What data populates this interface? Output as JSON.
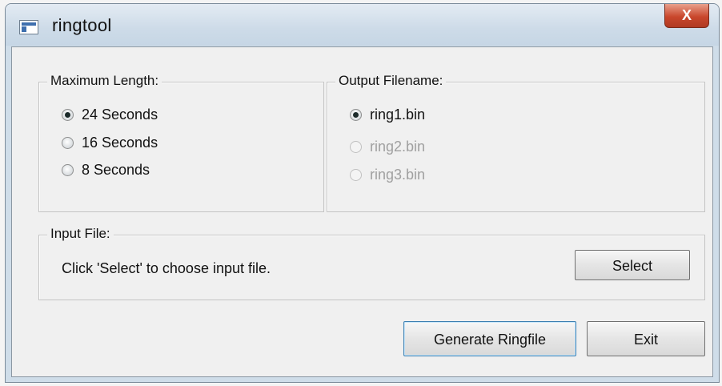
{
  "window": {
    "title": "ringtool",
    "close_label": "X"
  },
  "max_length": {
    "title": "Maximum Length:",
    "options": [
      {
        "label": "24 Seconds",
        "selected": true,
        "enabled": true
      },
      {
        "label": "16 Seconds",
        "selected": false,
        "enabled": true
      },
      {
        "label": "8 Seconds",
        "selected": false,
        "enabled": true
      }
    ]
  },
  "output_filename": {
    "title": "Output Filename:",
    "options": [
      {
        "label": "ring1.bin",
        "selected": true,
        "enabled": true
      },
      {
        "label": "ring2.bin",
        "selected": false,
        "enabled": false
      },
      {
        "label": "ring3.bin",
        "selected": false,
        "enabled": false
      }
    ]
  },
  "input_file": {
    "title": "Input File:",
    "hint": "Click 'Select' to choose input file.",
    "select_label": "Select"
  },
  "buttons": {
    "generate_label": "Generate Ringfile",
    "exit_label": "Exit"
  },
  "icons": {
    "app": "window-app-icon",
    "close": "close-icon"
  }
}
